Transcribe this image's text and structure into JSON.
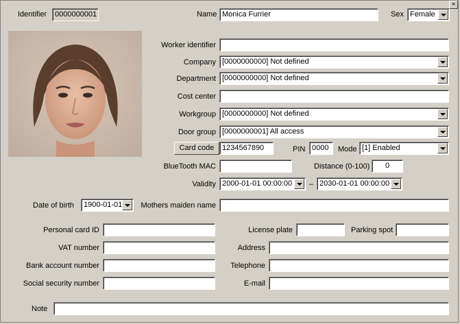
{
  "close_glyph": "×",
  "identifier": {
    "label": "Identifier",
    "value": "0000000001"
  },
  "name": {
    "label": "Name",
    "value": "Monica Furrier"
  },
  "sex": {
    "label": "Sex",
    "value": "Female"
  },
  "worker_identifier": {
    "label": "Worker identifier",
    "value": ""
  },
  "company": {
    "label": "Company",
    "value": "[0000000000] Not defined"
  },
  "department": {
    "label": "Department",
    "value": "[0000000000] Not defined"
  },
  "cost_center": {
    "label": "Cost center",
    "value": ""
  },
  "workgroup": {
    "label": "Workgroup",
    "value": "[0000000000] Not defined"
  },
  "door_group": {
    "label": "Door group",
    "value": "[0000000001] All access"
  },
  "card_code": {
    "button_label": "Card code",
    "value": "1234567890"
  },
  "pin": {
    "label": "PIN",
    "value": "0000"
  },
  "mode": {
    "label": "Mode",
    "value": "[1] Enabled"
  },
  "bluetooth_mac": {
    "label": "BlueTooth MAC",
    "value": ""
  },
  "distance": {
    "label": "Distance (0-100)",
    "value": "0"
  },
  "validity": {
    "label": "Validity",
    "from": "2000-01-01 00:00:00",
    "separator": "–",
    "to": "2030-01-01 00:00:00"
  },
  "date_of_birth": {
    "label": "Date of birth",
    "value": "1900-01-01"
  },
  "mothers_maiden_name": {
    "label": "Mothers maiden name",
    "value": ""
  },
  "personal_card_id": {
    "label": "Personal card ID",
    "value": ""
  },
  "license_plate": {
    "label": "License plate",
    "value": ""
  },
  "parking_spot": {
    "label": "Parking spot",
    "value": ""
  },
  "vat_number": {
    "label": "VAT number",
    "value": ""
  },
  "address": {
    "label": "Address",
    "value": ""
  },
  "bank_account_number": {
    "label": "Bank account number",
    "value": ""
  },
  "telephone": {
    "label": "Telephone",
    "value": ""
  },
  "social_security_number": {
    "label": "Social security number",
    "value": ""
  },
  "email": {
    "label": "E-mail",
    "value": ""
  },
  "note": {
    "label": "Note",
    "value": ""
  },
  "colors": {
    "background": "#d4d0c8",
    "field": "#ffffff",
    "shadow": "#808080"
  },
  "photo_icon": "person-photo"
}
